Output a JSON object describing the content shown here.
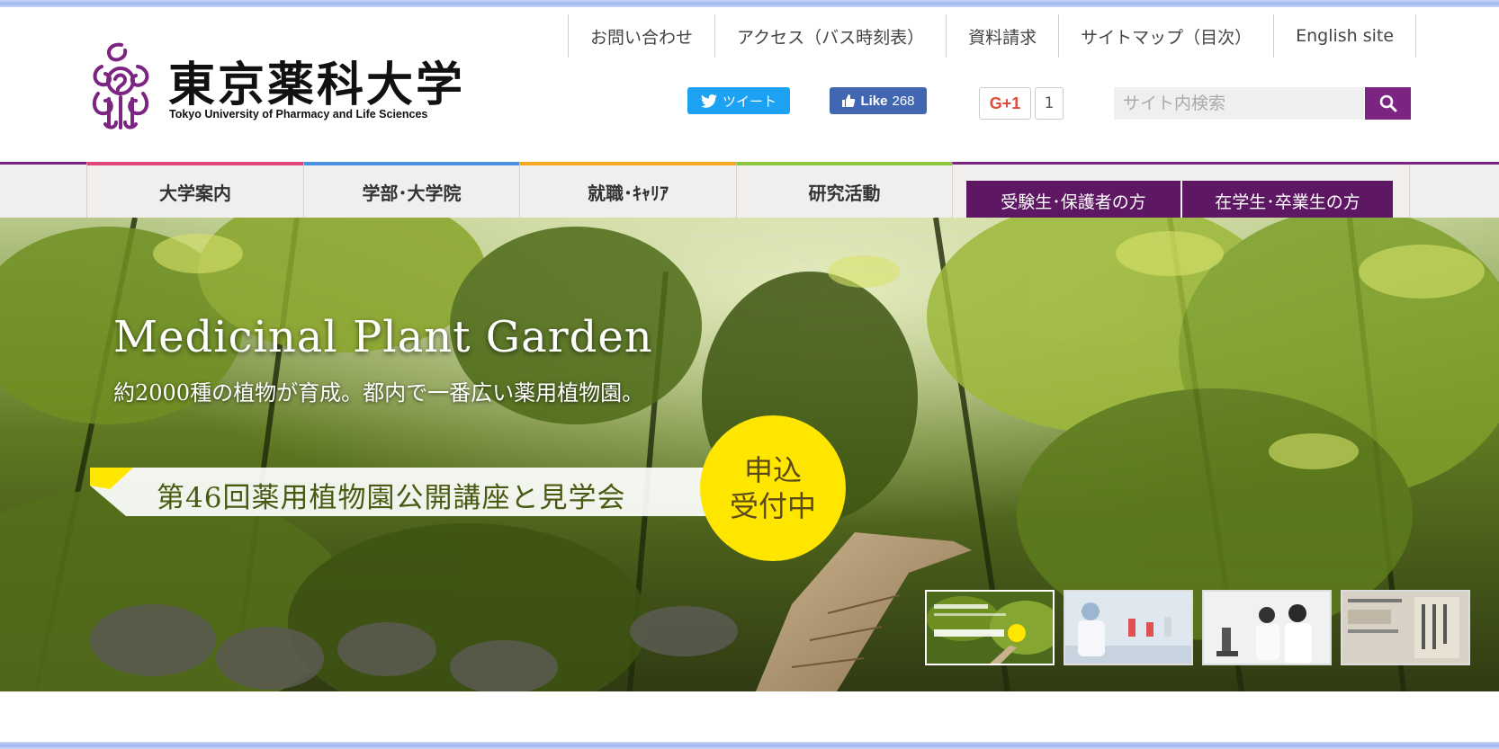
{
  "header": {
    "logo": {
      "name_jp": "東京薬科大学",
      "name_en": "Tokyo University of Pharmacy and Life Sciences",
      "mark_icon": "university-crest-logo"
    },
    "top_links": [
      "お問い合わせ",
      "アクセス（バス時刻表）",
      "資料請求",
      "サイトマップ（目次）",
      "English site"
    ],
    "social": {
      "tweet_label": "ツイート",
      "like_label": "Like",
      "like_count": "268",
      "gplus_label": "G+1",
      "gplus_count": "1"
    },
    "search": {
      "placeholder": "サイト内検索",
      "button_icon": "search-icon"
    }
  },
  "nav": {
    "items": [
      {
        "label": "大学案内",
        "accent": "#e0457b"
      },
      {
        "label": "学部･大学院",
        "accent": "#4a90e2"
      },
      {
        "label": "就職･ｷｬﾘｱ",
        "accent": "#f5a623"
      },
      {
        "label": "研究活動",
        "accent": "#8cc63f"
      }
    ],
    "buttons": [
      "受験生･保護者の方",
      "在学生･卒業生の方"
    ],
    "brand_color": "#7b2481"
  },
  "hero": {
    "title": "Medicinal Plant Garden",
    "subtitle": "約2000種の植物が育成。都内で一番広い薬用植物園。",
    "banner_text": "第46回薬用植物園公開講座と見学会",
    "badge_line1": "申込",
    "badge_line2": "受付中",
    "thumbnails": [
      {
        "name": "thumb-plant-garden",
        "active": true
      },
      {
        "name": "thumb-laboratory",
        "active": false
      },
      {
        "name": "thumb-microscope-students",
        "active": false
      },
      {
        "name": "thumb-history-document",
        "active": false
      }
    ]
  }
}
